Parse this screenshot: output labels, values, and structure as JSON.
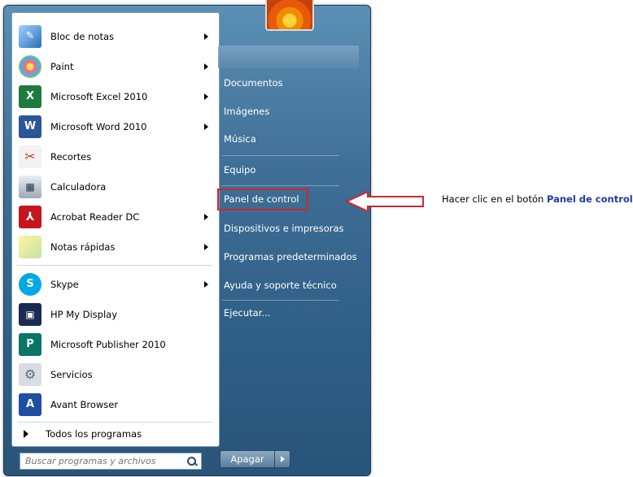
{
  "left_menu": {
    "apps": [
      {
        "label": "Bloc de notas",
        "icon": "notepad-icon",
        "has_arrow": true
      },
      {
        "label": "Paint",
        "icon": "paint-icon",
        "has_arrow": true
      },
      {
        "label": "Microsoft Excel 2010",
        "icon": "excel-icon",
        "has_arrow": true
      },
      {
        "label": "Microsoft Word 2010",
        "icon": "word-icon",
        "has_arrow": true
      },
      {
        "label": "Recortes",
        "icon": "snipping-tool-icon",
        "has_arrow": false
      },
      {
        "label": "Calculadora",
        "icon": "calculator-icon",
        "has_arrow": false
      },
      {
        "label": "Acrobat Reader DC",
        "icon": "acrobat-icon",
        "has_arrow": true
      },
      {
        "label": "Notas rápidas",
        "icon": "sticky-notes-icon",
        "has_arrow": true
      },
      {
        "label": "Skype",
        "icon": "skype-icon",
        "has_arrow": true
      },
      {
        "label": "HP My Display",
        "icon": "hp-display-icon",
        "has_arrow": false
      },
      {
        "label": "Microsoft Publisher 2010",
        "icon": "publisher-icon",
        "has_arrow": false
      },
      {
        "label": "Servicios",
        "icon": "services-icon",
        "has_arrow": false
      },
      {
        "label": "Avant Browser",
        "icon": "avant-browser-icon",
        "has_arrow": false
      }
    ],
    "all_programs_label": "Todos los programas",
    "search_placeholder": "Buscar programas y archivos"
  },
  "right_menu": {
    "items": [
      {
        "label": "Documentos"
      },
      {
        "label": "Imágenes"
      },
      {
        "label": "Música"
      },
      {
        "label": "Equipo"
      },
      {
        "label": "Panel de control"
      },
      {
        "label": "Dispositivos e impresoras"
      },
      {
        "label": "Programas predeterminados"
      },
      {
        "label": "Ayuda y soporte técnico"
      },
      {
        "label": "Ejecutar..."
      }
    ],
    "shutdown_label": "Apagar"
  },
  "annotation": {
    "text": "Hacer clic en el botón",
    "bold": "Panel de control"
  },
  "colors": {
    "highlight": "#d1262e",
    "menu_blue": "#3f6f96",
    "annotation_bold": "#1f3aa8"
  }
}
